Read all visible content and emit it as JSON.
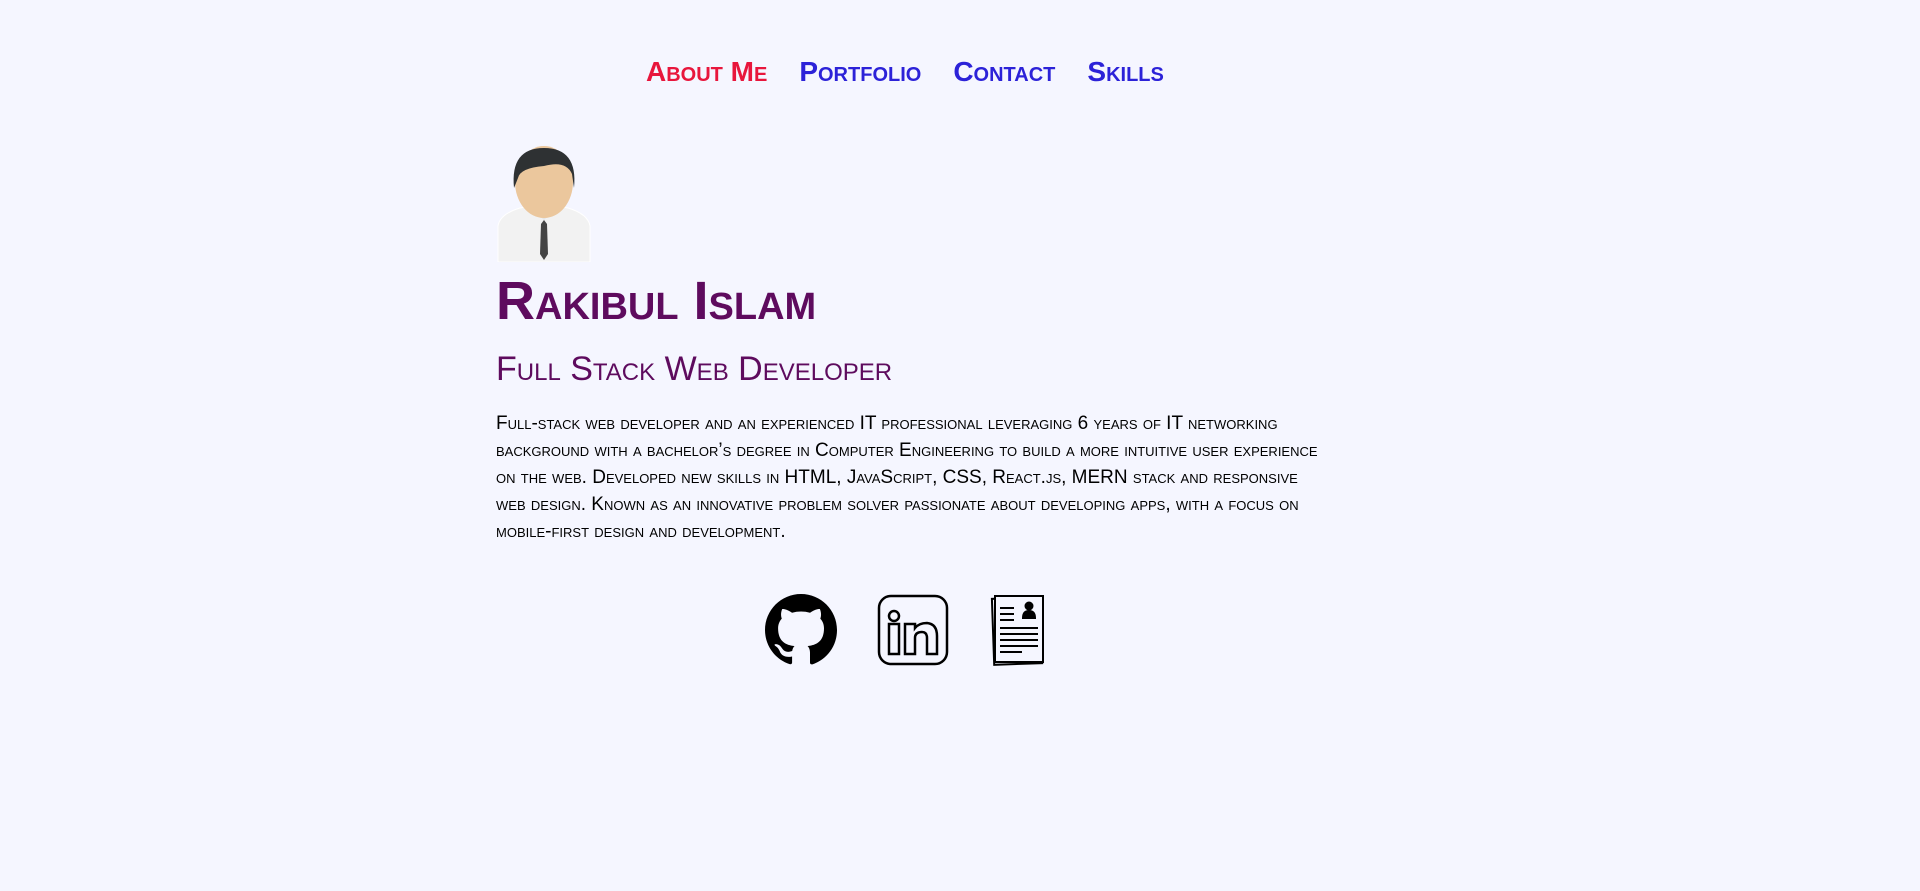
{
  "nav": {
    "items": [
      {
        "label": "About Me",
        "active": true
      },
      {
        "label": "Portfolio"
      },
      {
        "label": "Contact"
      },
      {
        "label": "Skills"
      }
    ]
  },
  "colors": {
    "background": "#f5f6ff",
    "nav_active": "#e8163c",
    "nav": "#2c22d8",
    "heading": "#5e0b5e"
  },
  "profile": {
    "name": "Rakibul Islam",
    "title": "Full Stack Web Developer",
    "bio": "Full-stack web developer and an experienced IT professional leveraging 6 years of IT networking background with a bachelor’s degree in Computer Engineering to build a more intuitive user experience on the web. Developed new skills in HTML, JavaScript, CSS, React.js, MERN stack and responsive web design. Known as an innovative problem solver passionate about developing apps, with a focus on mobile-first design and development."
  },
  "links": [
    {
      "icon": "github-icon"
    },
    {
      "icon": "linkedin-icon"
    },
    {
      "icon": "resume-icon"
    }
  ]
}
